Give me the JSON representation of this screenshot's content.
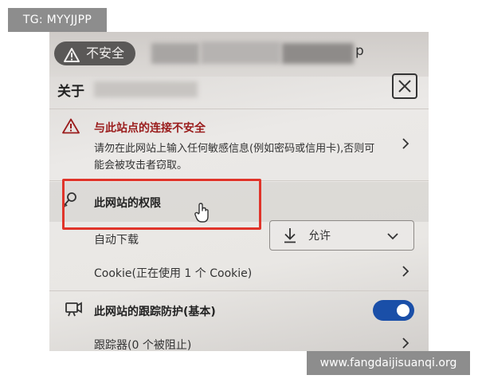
{
  "watermarks": {
    "top_left": "TG: MYYJJPP",
    "bottom_right": "www.fangdaijisuanqi.org"
  },
  "address_bar": {
    "security_label": "不安全",
    "url_tail": "p"
  },
  "panel": {
    "title": "关于",
    "warning": {
      "title": "与此站点的连接不安全",
      "description": "请勿在此网站上输入任何敏感信息(例如密码或信用卡),否则可能会被攻击者窃取。"
    },
    "permissions": {
      "label": "此网站的权限",
      "auto_download": {
        "label": "自动下载",
        "value": "允许"
      },
      "cookie_label": "Cookie(正在使用 1 个 Cookie)"
    },
    "tracking": {
      "label": "此网站的跟踪防护(基本)",
      "enabled": true,
      "trackers_label": "跟踪器(0 个被阻止)"
    }
  },
  "colors": {
    "warning_red": "#9a1c1c",
    "highlight_red": "#e0342a",
    "toggle_blue": "#1a4fa8"
  },
  "icons": [
    "warning-icon",
    "close-icon",
    "key-icon",
    "hand-cursor-icon",
    "download-icon",
    "chevron-down-icon",
    "chevron-right-icon",
    "tracking-icon"
  ]
}
